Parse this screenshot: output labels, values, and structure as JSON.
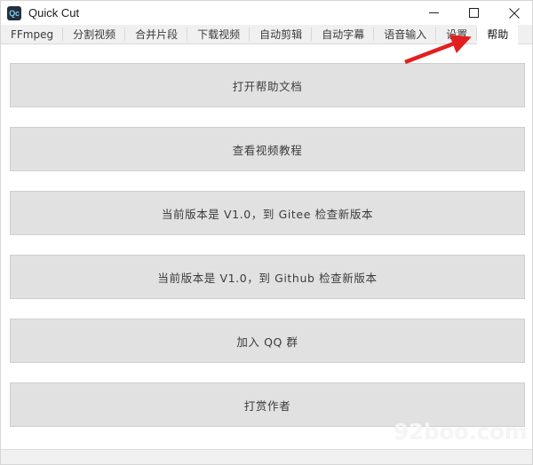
{
  "window": {
    "title": "Quick Cut",
    "icon_label": "Qc",
    "icon_name": "app-icon",
    "colors": {
      "icon_bg": "#24303f",
      "icon_fg": "#7ecbf0",
      "tab_bar_bg": "#f0f0f0",
      "button_bg": "#e1e1e1",
      "button_border": "#cfcfcf",
      "panel_bg": "#ffffff",
      "annotation_red": "#e21f1f"
    },
    "controls": [
      {
        "name": "minimize-button",
        "glyph": "minimize-icon",
        "label": "—"
      },
      {
        "name": "maximize-button",
        "glyph": "maximize-icon",
        "label": "□"
      },
      {
        "name": "close-button",
        "glyph": "close-icon",
        "label": "×"
      }
    ]
  },
  "tabs": [
    {
      "label": "FFmpeg",
      "selected": false
    },
    {
      "label": "分割视频",
      "selected": false
    },
    {
      "label": "合并片段",
      "selected": false
    },
    {
      "label": "下载视频",
      "selected": false
    },
    {
      "label": "自动剪辑",
      "selected": false
    },
    {
      "label": "自动字幕",
      "selected": false
    },
    {
      "label": "语音输入",
      "selected": false
    },
    {
      "label": "设置",
      "selected": false
    },
    {
      "label": "帮助",
      "selected": true
    }
  ],
  "main": {
    "buttons": [
      {
        "label": "打开帮助文档",
        "name": "open-help-doc-button"
      },
      {
        "label": "查看视频教程",
        "name": "view-video-tutorial-button"
      },
      {
        "label": "当前版本是 V1.0，到 Gitee 检查新版本",
        "name": "check-update-gitee-button"
      },
      {
        "label": "当前版本是 V1.0，到 Github 检查新版本",
        "name": "check-update-github-button"
      },
      {
        "label": "加入 QQ 群",
        "name": "join-qq-group-button"
      },
      {
        "label": "打赏作者",
        "name": "donate-author-button"
      }
    ]
  },
  "annotation": {
    "type": "red-arrow",
    "points_to": "帮助"
  },
  "watermark": {
    "text": "92boo.com"
  }
}
